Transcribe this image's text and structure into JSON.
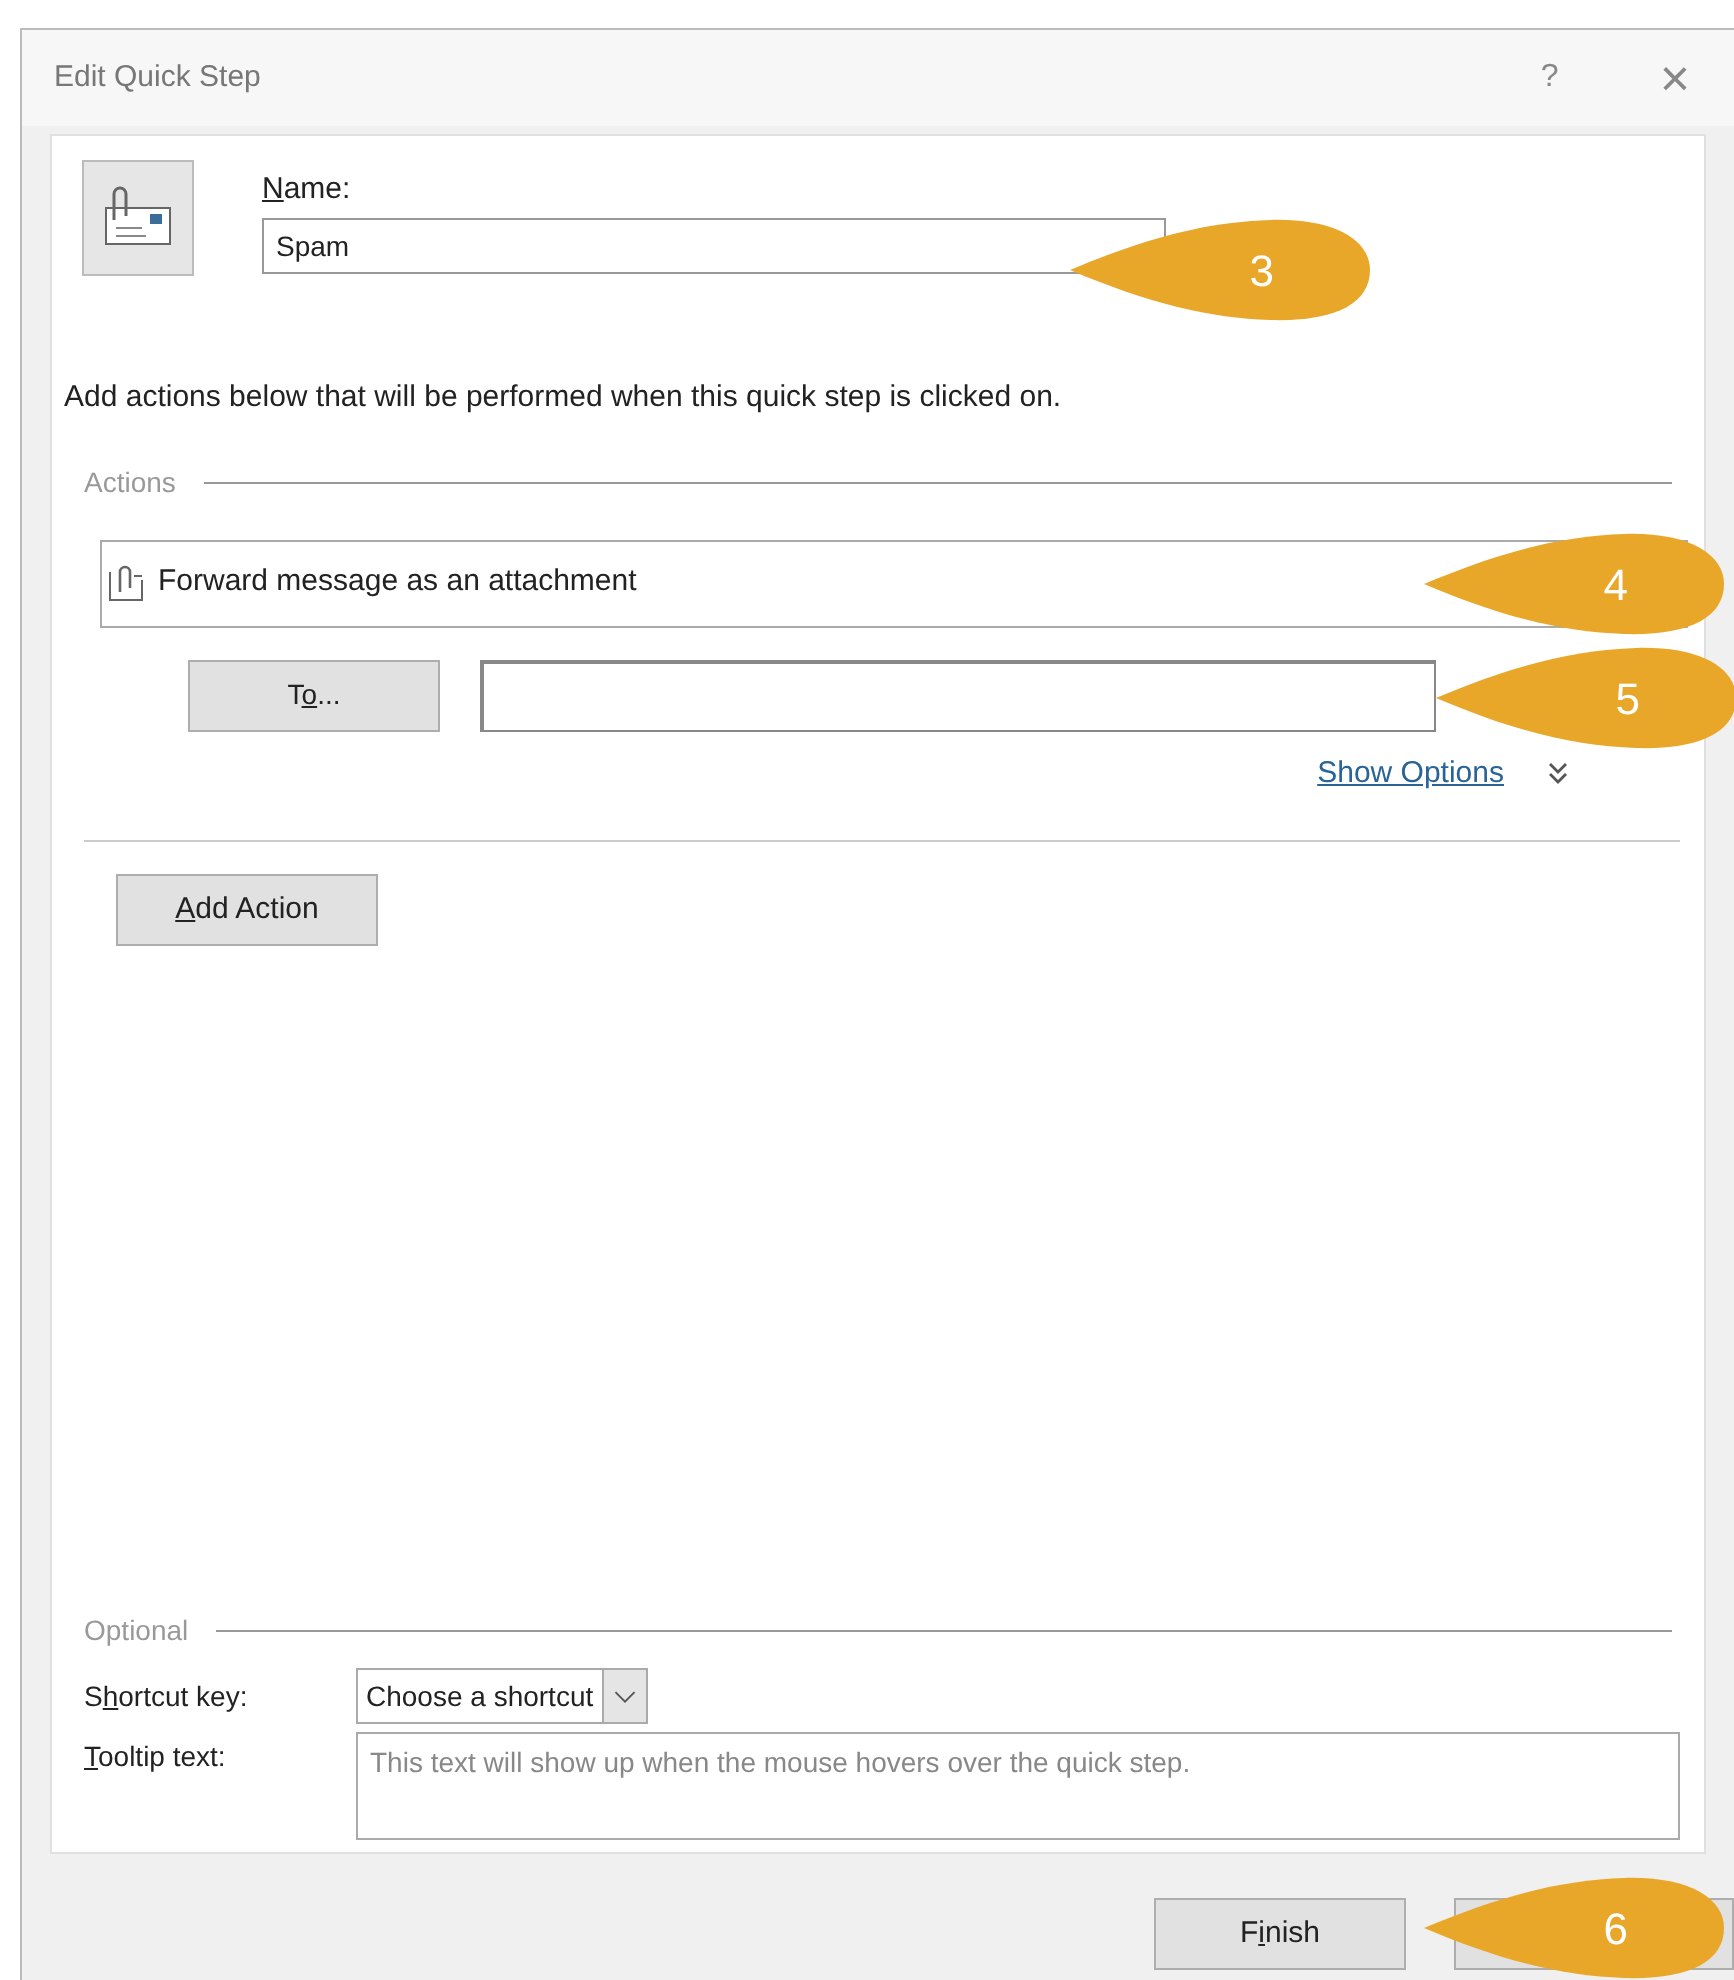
{
  "window": {
    "title": "Edit Quick Step",
    "help": "?",
    "close": "×"
  },
  "name_label": {
    "key": "N",
    "post": "ame:"
  },
  "name_value": "Spam",
  "instructions": "Add actions below that will be performed when this quick step is clicked on.",
  "actions_group": "Actions",
  "action": {
    "label": "Forward message as an attachment"
  },
  "to_button": {
    "pre": "T",
    "key": "o",
    "post": "..."
  },
  "show_options": "Show Options",
  "add_action": {
    "key": "A",
    "post": "dd Action"
  },
  "optional_group": "Optional",
  "shortcut_label": {
    "pre": "S",
    "key": "h",
    "post": "ortcut key:"
  },
  "shortcut_value": "Choose a shortcut",
  "tooltip_label": {
    "key": "T",
    "post": "ooltip text:"
  },
  "tooltip_placeholder": "This text will show up when the mouse hovers over the quick step.",
  "finish": {
    "pre": "F",
    "key": "i",
    "post": "nish"
  },
  "callouts": [
    {
      "number": "3"
    },
    {
      "number": "4"
    },
    {
      "number": "5"
    },
    {
      "number": "6"
    }
  ]
}
